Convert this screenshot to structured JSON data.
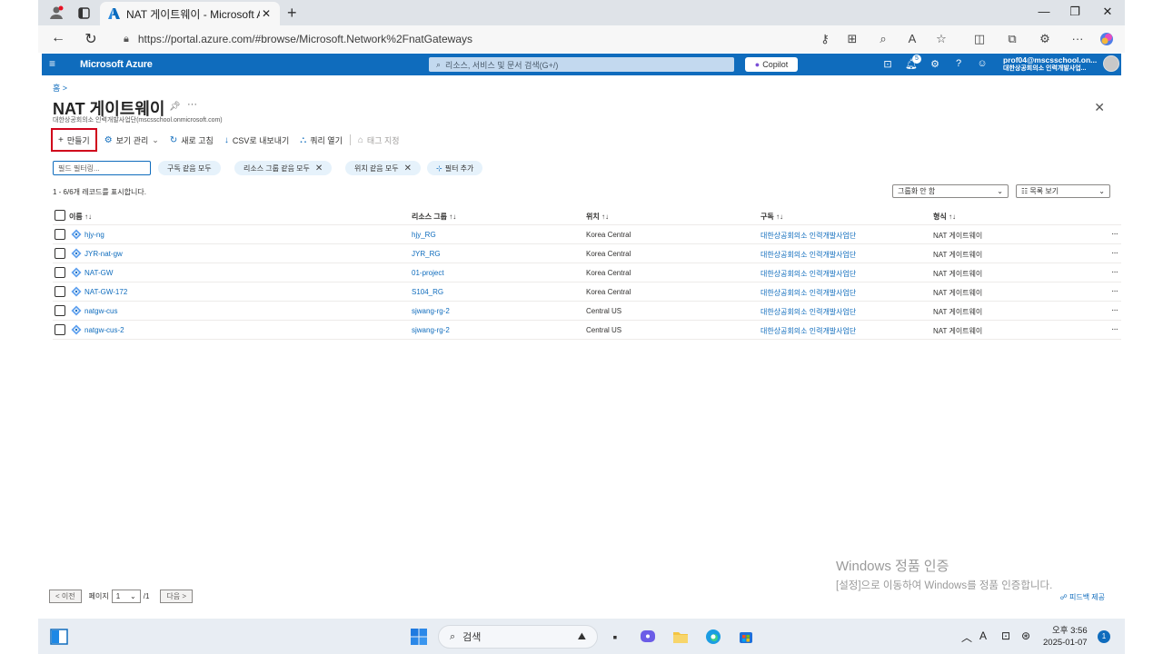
{
  "browser": {
    "tab_title": "NAT 게이트웨이 - Microsoft Azure",
    "url": "https://portal.azure.com/#browse/Microsoft.Network%2FnatGateways"
  },
  "azure": {
    "brand": "Microsoft Azure",
    "search_placeholder": "리소스, 서비스 및 문서 검색(G+/)",
    "copilot_label": "Copilot",
    "notification_count": "5",
    "account_email": "prof04@mscsschool.on...",
    "account_org": "대한상공회의소 인력개발사업..."
  },
  "page": {
    "breadcrumb": "홈 >",
    "title": "NAT 게이트웨이",
    "subtitle": "대한상공회의소 인력개발사업단(mscsschool.onmicrosoft.com)"
  },
  "toolbar": {
    "create": "만들기",
    "manage_view": "보기 관리",
    "refresh": "새로 고침",
    "export_csv": "CSV로 내보내기",
    "open_query": "쿼리 열기",
    "assign_tags": "태그 지정"
  },
  "filters": {
    "field_filter_placeholder": "필드 필터링...",
    "subscription": "구독 같음 모두",
    "resource_group": "리소스 그룹 같음 모두",
    "location": "위치 같음 모두",
    "add_filter": "필터 추가"
  },
  "list": {
    "record_count": "1 - 6/6개 레코드를 표시합니다.",
    "grouping": "그룹화 안 함",
    "view_mode": "목록 보기",
    "columns": {
      "name": "이름 ↑↓",
      "resource_group": "리소스 그룹 ↑↓",
      "location": "위치 ↑↓",
      "subscription": "구독 ↑↓",
      "type": "형식 ↑↓"
    },
    "rows": [
      {
        "name": "hjy-ng",
        "resource_group": "hjy_RG",
        "location": "Korea Central",
        "subscription": "대한상공회의소 인력개발사업단",
        "type": "NAT 게이트웨이"
      },
      {
        "name": "JYR-nat-gw",
        "resource_group": "JYR_RG",
        "location": "Korea Central",
        "subscription": "대한상공회의소 인력개발사업단",
        "type": "NAT 게이트웨이"
      },
      {
        "name": "NAT-GW",
        "resource_group": "01-project",
        "location": "Korea Central",
        "subscription": "대한상공회의소 인력개발사업단",
        "type": "NAT 게이트웨이"
      },
      {
        "name": "NAT-GW-172",
        "resource_group": "S104_RG",
        "location": "Korea Central",
        "subscription": "대한상공회의소 인력개발사업단",
        "type": "NAT 게이트웨이"
      },
      {
        "name": "natgw-cus",
        "resource_group": "sjwang-rg-2",
        "location": "Central US",
        "subscription": "대한상공회의소 인력개발사업단",
        "type": "NAT 게이트웨이"
      },
      {
        "name": "natgw-cus-2",
        "resource_group": "sjwang-rg-2",
        "location": "Central US",
        "subscription": "대한상공회의소 인력개발사업단",
        "type": "NAT 게이트웨이"
      }
    ]
  },
  "pager": {
    "prev": "< 이전",
    "page_label": "페이지",
    "page_value": "1",
    "total": "/1",
    "next": "다음 >"
  },
  "watermark": {
    "line1": "Windows 정품 인증",
    "line2": "[설정]으로 이동하여 Windows를 정품 인증합니다."
  },
  "feedback": "피드백 제공",
  "taskbar": {
    "search": "검색",
    "time": "오후 3:56",
    "date": "2025-01-07",
    "notification_count": "1"
  },
  "colors": {
    "azure_blue": "#0f6cbd",
    "highlight_red": "#d0021b"
  }
}
